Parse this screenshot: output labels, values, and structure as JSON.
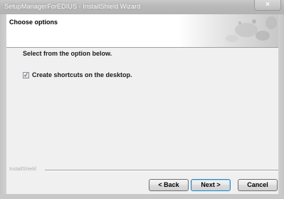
{
  "window": {
    "title": "SetupManagerForEDIUS - InstallShield Wizard",
    "close_icon": "close-icon",
    "close_glyph": "×"
  },
  "header": {
    "title": "Choose options"
  },
  "body": {
    "instruction": "Select from the option below.",
    "options": [
      {
        "label": "Create shortcuts on the desktop.",
        "checked": true
      }
    ],
    "check_glyph": "✓"
  },
  "footer": {
    "brand": "InstallShield",
    "back_label": "< Back",
    "next_label": "Next >",
    "cancel_label": "Cancel"
  },
  "colors": {
    "accent": "#3c7fb1",
    "titlebar": "#b9b9b9",
    "header_bg": "#ffffff",
    "body_bg": "#f0f0f0"
  }
}
